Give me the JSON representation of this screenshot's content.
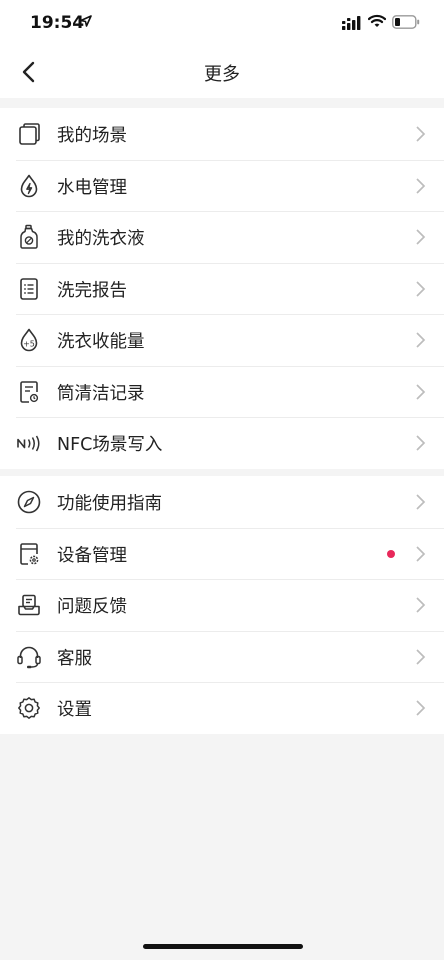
{
  "status": {
    "time": "19:54"
  },
  "header": {
    "title": "更多"
  },
  "group1": [
    {
      "label": "我的场景",
      "icon": "scene-icon"
    },
    {
      "label": "水电管理",
      "icon": "water-power-icon"
    },
    {
      "label": "我的洗衣液",
      "icon": "detergent-icon"
    },
    {
      "label": "洗完报告",
      "icon": "report-icon"
    },
    {
      "label": "洗衣收能量",
      "icon": "energy-drop-icon"
    },
    {
      "label": "筒清洁记录",
      "icon": "drum-clean-record-icon"
    },
    {
      "label": "NFC场景写入",
      "icon": "nfc-icon"
    }
  ],
  "group2": [
    {
      "label": "功能使用指南",
      "icon": "compass-icon"
    },
    {
      "label": "设备管理",
      "icon": "device-settings-icon",
      "badge": true
    },
    {
      "label": "问题反馈",
      "icon": "feedback-tray-icon"
    },
    {
      "label": "客服",
      "icon": "headset-icon"
    },
    {
      "label": "设置",
      "icon": "gear-icon"
    }
  ],
  "colors": {
    "badge": "#e8285a",
    "background": "#f4f4f4",
    "divider": "#ececec"
  }
}
